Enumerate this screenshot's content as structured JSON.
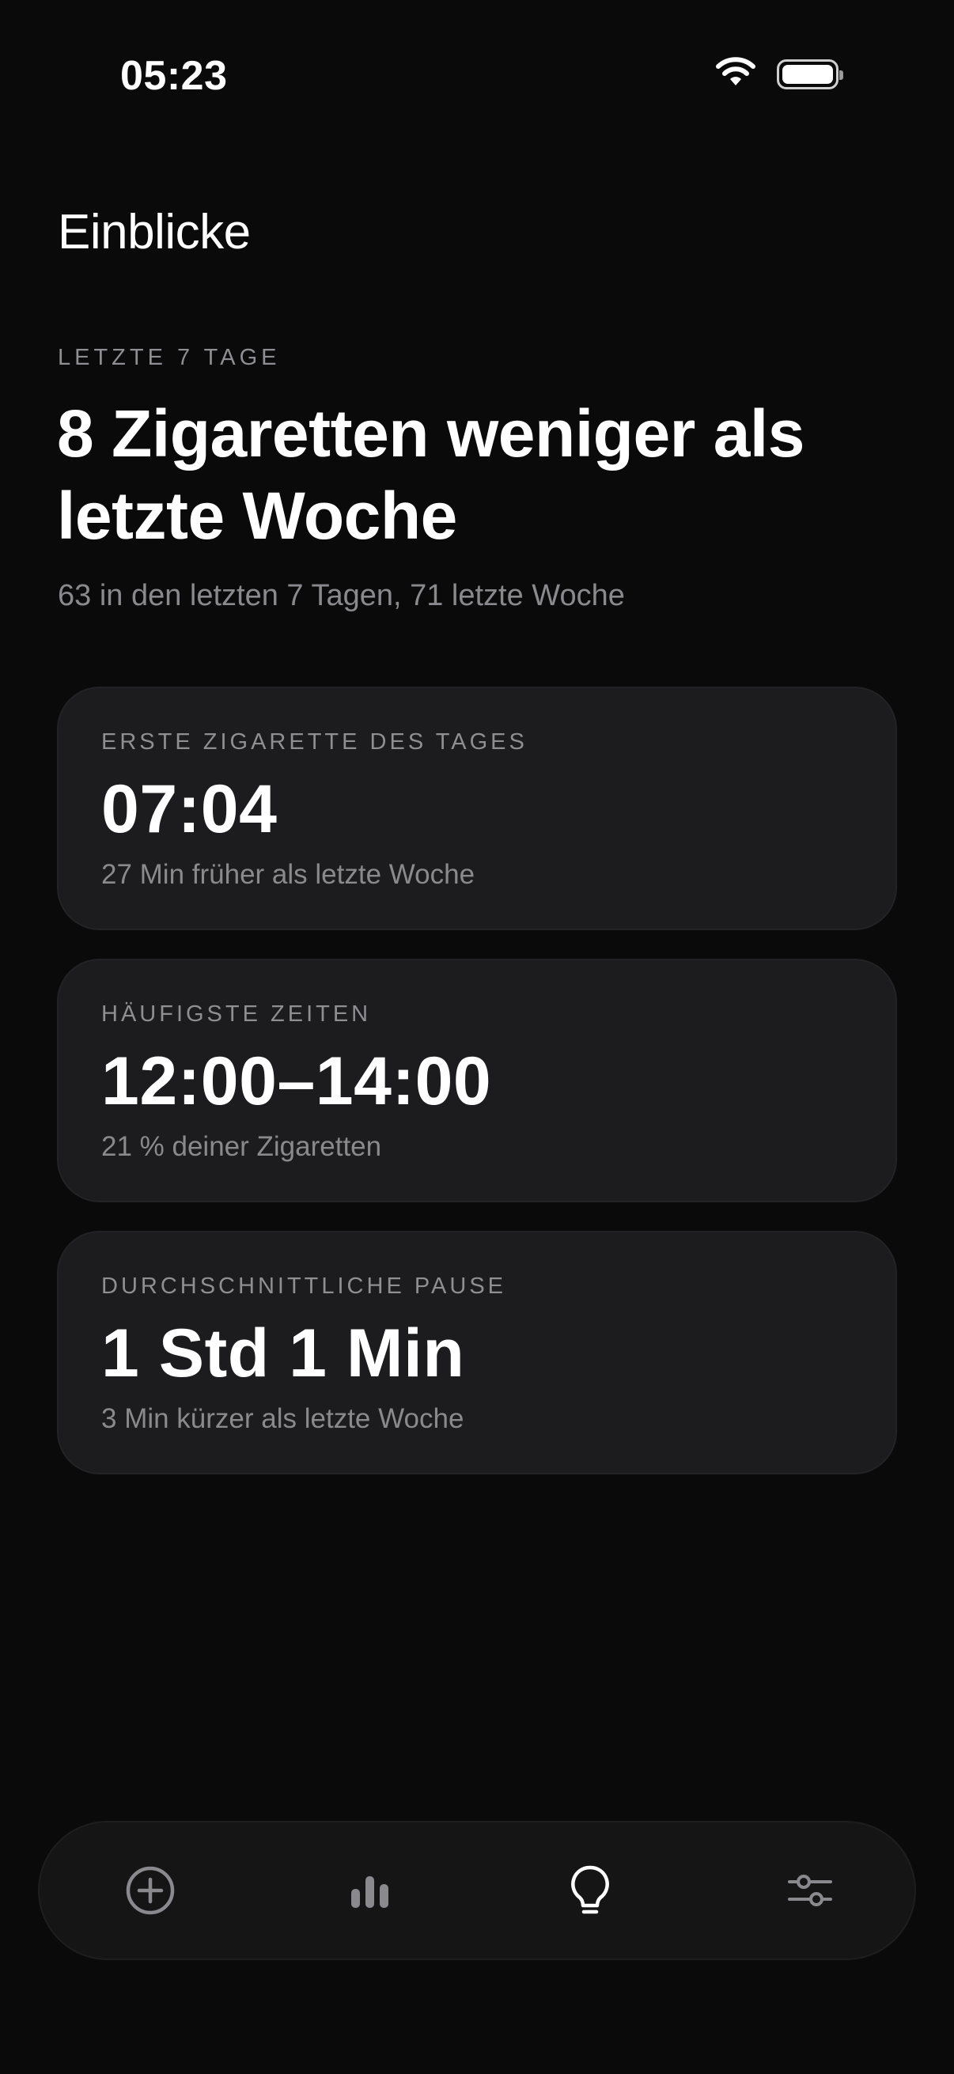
{
  "status_bar": {
    "time": "05:23"
  },
  "header": {
    "title": "Einblicke"
  },
  "summary": {
    "period_label": "LETZTE 7 TAGE",
    "headline": "8 Zigaretten weniger als letzte Woche",
    "detail": "63 in den letzten 7 Tagen, 71 letzte Woche"
  },
  "cards": [
    {
      "label": "ERSTE ZIGARETTE DES TAGES",
      "value": "07:04",
      "note": "27 Min früher als letzte Woche"
    },
    {
      "label": "HÄUFIGSTE ZEITEN",
      "value": "12:00–14:00",
      "note": "21 % deiner Zigaretten"
    },
    {
      "label": "DURCHSCHNITTLICHE PAUSE",
      "value": "1 Std 1 Min",
      "note": "3 Min kürzer als letzte Woche"
    }
  ],
  "tab_bar": {
    "tabs": [
      {
        "icon": "plus-circle-icon",
        "active": false
      },
      {
        "icon": "bar-chart-icon",
        "active": false
      },
      {
        "icon": "lightbulb-icon",
        "active": true
      },
      {
        "icon": "sliders-icon",
        "active": false
      }
    ],
    "active_color": "#ffffff",
    "inactive_color": "#8a8a8e"
  }
}
